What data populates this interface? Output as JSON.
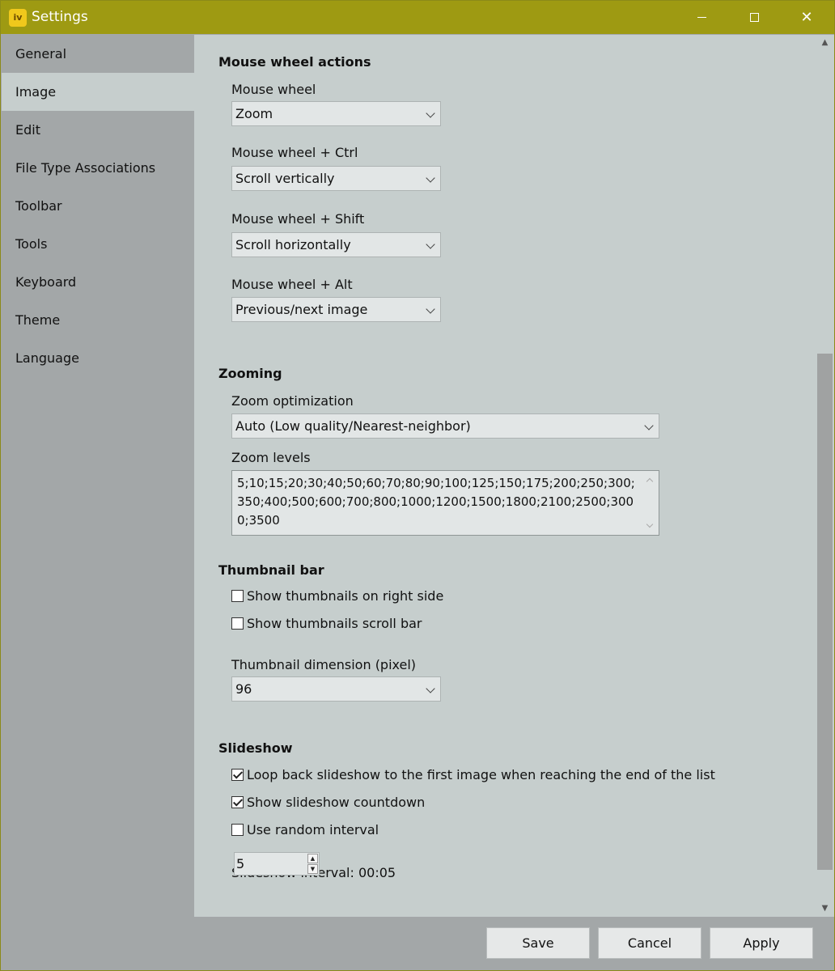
{
  "window": {
    "title": "Settings",
    "app_icon_glyph": "iv",
    "accent_color": "#9e9a12"
  },
  "sidebar": {
    "items": [
      {
        "label": "General"
      },
      {
        "label": "Image"
      },
      {
        "label": "Edit"
      },
      {
        "label": "File Type Associations"
      },
      {
        "label": "Toolbar"
      },
      {
        "label": "Tools"
      },
      {
        "label": "Keyboard"
      },
      {
        "label": "Theme"
      },
      {
        "label": "Language"
      }
    ],
    "active": "Image"
  },
  "mouse_wheel": {
    "section_title": "Mouse wheel actions",
    "wheel_label": "Mouse wheel",
    "wheel_value": "Zoom",
    "ctrl_label": "Mouse wheel + Ctrl",
    "ctrl_value": "Scroll vertically",
    "shift_label": "Mouse wheel + Shift",
    "shift_value": "Scroll horizontally",
    "alt_label": "Mouse wheel + Alt",
    "alt_value": "Previous/next image"
  },
  "zooming": {
    "section_title": "Zooming",
    "optimization_label": "Zoom optimization",
    "optimization_value": "Auto (Low quality/Nearest-neighbor)",
    "levels_label": "Zoom levels",
    "levels_value": "5;10;15;20;30;40;50;60;70;80;90;100;125;150;175;200;250;300;350;400;500;600;700;800;1000;1200;1500;1800;2100;2500;3000;3500"
  },
  "thumbnail": {
    "section_title": "Thumbnail bar",
    "right_side_label": "Show thumbnails on right side",
    "right_side_checked": false,
    "scrollbar_label": "Show thumbnails scroll bar",
    "scrollbar_checked": false,
    "dimension_label": "Thumbnail dimension (pixel)",
    "dimension_value": "96"
  },
  "slideshow": {
    "section_title": "Slideshow",
    "loop_label": "Loop back slideshow to the first image when reaching the end of the list",
    "loop_checked": true,
    "countdown_label": "Show slideshow countdown",
    "countdown_checked": true,
    "random_label": "Use random interval",
    "random_checked": false,
    "interval_label": "Slideshow interval: 00:05",
    "interval_value": "5"
  },
  "footer": {
    "save_label": "Save",
    "cancel_label": "Cancel",
    "apply_label": "Apply"
  }
}
